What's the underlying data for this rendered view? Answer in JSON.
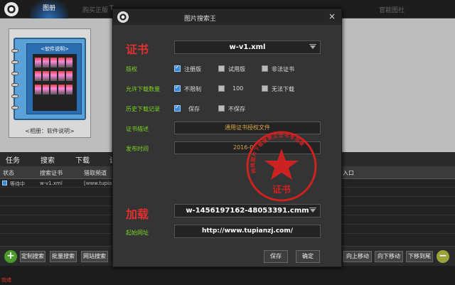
{
  "topbar": {
    "tab_album": "图册",
    "link_buy": "购买正版",
    "link_t": "T",
    "link_official": "官能图社"
  },
  "album": {
    "book_title": "<软件说明>",
    "book_caption": "<相册：软件说明>"
  },
  "tabs": [
    "任务",
    "搜索",
    "下载",
    "设"
  ],
  "table": {
    "headers": [
      "状态",
      "搜索证书",
      "猎取频道",
      "入口"
    ],
    "rows": [
      {
        "status": "等待中",
        "cert": "w-v1.xml",
        "channel": "[www.tupia"
      }
    ]
  },
  "bottom": {
    "custom_search": "定制搜索",
    "batch_search": "批量搜索",
    "site_search": "网站搜索",
    "move_up": "向上移动",
    "move_down": "向下移动",
    "move_bottom": "下移到尾",
    "add_symbol": "+",
    "remove_symbol": "−",
    "status_text": "就绪"
  },
  "dialog": {
    "title": "图片搜索王",
    "close": "×",
    "cert_heading": "证书",
    "cert_select": "w-v1.xml",
    "labels": {
      "license": "版权",
      "allow_count": "允许下载数量",
      "history": "历史下载记录",
      "cert_desc": "证书描述",
      "publish_time": "发布时间",
      "start_url": "起始网址"
    },
    "license_options": [
      {
        "label": "注册版",
        "checked": true
      },
      {
        "label": "试用版",
        "checked": false
      },
      {
        "label": "非法证书",
        "checked": false
      }
    ],
    "count_options": [
      {
        "label": "不限制",
        "checked": true
      },
      {
        "label": "100",
        "checked": false
      },
      {
        "label": "无法下载",
        "checked": false
      }
    ],
    "history_options": [
      {
        "label": "保存",
        "checked": true
      },
      {
        "label": "不保存",
        "checked": false
      }
    ],
    "cert_desc_value": "通用证书授权文件",
    "publish_value": "2016-0",
    "load_heading": "加载",
    "load_select": "w-1456197162-48053391.cmm",
    "start_url_value": "http://www.tupianzj.com/",
    "save_button": "保存",
    "ok_button": "确定",
    "seal_center": "证书",
    "seal_ring_text": "网络图片下载搜索王证书专用章"
  },
  "colors": {
    "accent_blue": "#2f6fb2",
    "label_green": "#7ed321",
    "seal_red": "#e03030",
    "field_orange": "#d9a441"
  }
}
